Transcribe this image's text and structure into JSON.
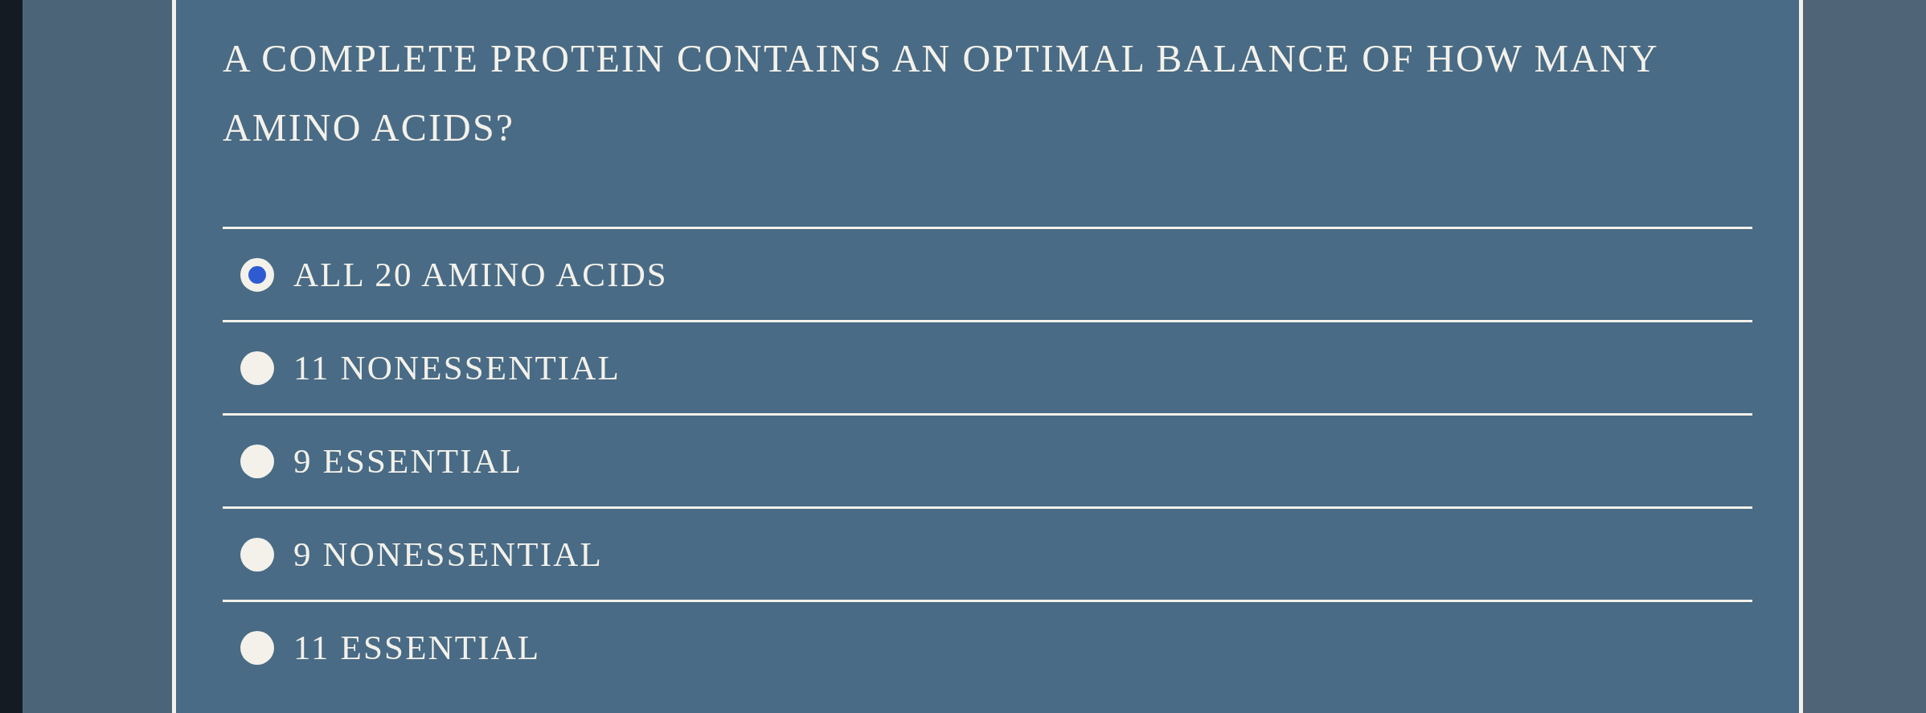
{
  "question": {
    "text": "A COMPLETE PROTEIN CONTAINS AN OPTIMAL BALANCE OF HOW MANY AMINO ACIDS?"
  },
  "options": [
    {
      "label": "ALL 20 AMINO ACIDS",
      "selected": true
    },
    {
      "label": "11 NONESSENTIAL",
      "selected": false
    },
    {
      "label": "9 ESSENTIAL",
      "selected": false
    },
    {
      "label": "9 NONESSENTIAL",
      "selected": false
    },
    {
      "label": "11 ESSENTIAL",
      "selected": false
    }
  ]
}
